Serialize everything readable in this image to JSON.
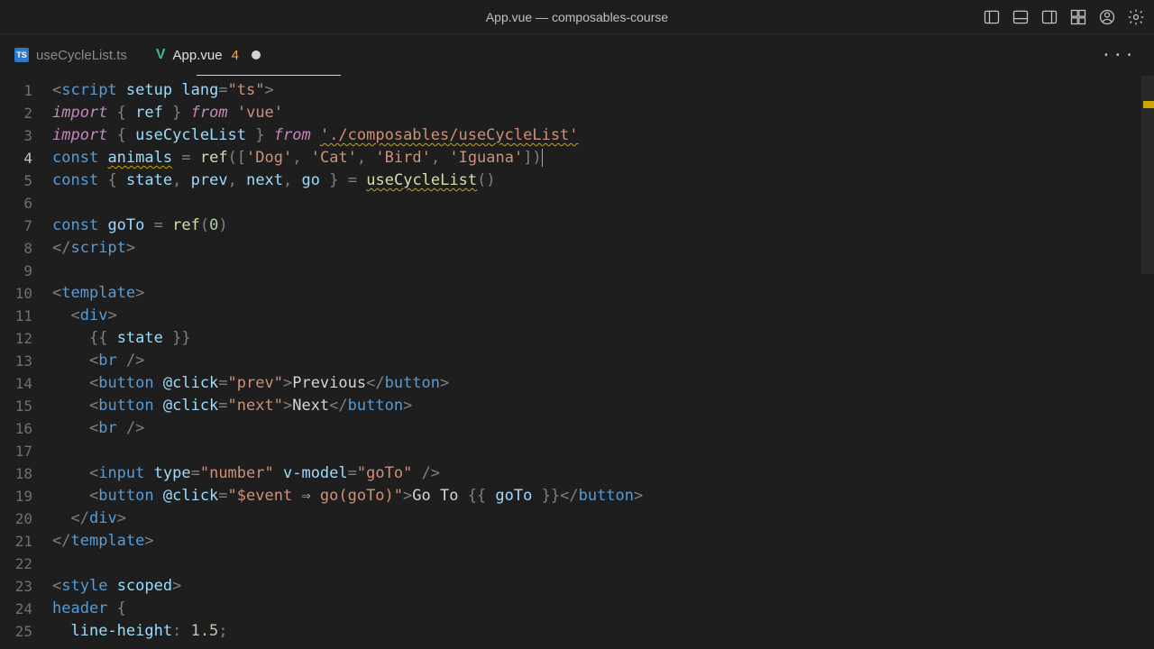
{
  "window": {
    "title": "App.vue — composables-course"
  },
  "tabs": [
    {
      "icon": "ts",
      "label": "useCycleList.ts",
      "active": false
    },
    {
      "icon": "vue",
      "label": "App.vue",
      "badge": "4",
      "dirty": true,
      "active": true
    }
  ],
  "currentLine": 4,
  "lines": [
    {
      "n": 1,
      "t": [
        [
          "pun",
          "<"
        ],
        [
          "tag",
          "script"
        ],
        [
          "txt",
          " "
        ],
        [
          "attr",
          "setup"
        ],
        [
          "txt",
          " "
        ],
        [
          "attr",
          "lang"
        ],
        [
          "pun",
          "="
        ],
        [
          "str",
          "\"ts\""
        ],
        [
          "pun",
          ">"
        ]
      ]
    },
    {
      "n": 2,
      "t": [
        [
          "kw",
          "import"
        ],
        [
          "txt",
          " "
        ],
        [
          "pun",
          "{"
        ],
        [
          "txt",
          " "
        ],
        [
          "var",
          "ref"
        ],
        [
          "txt",
          " "
        ],
        [
          "pun",
          "}"
        ],
        [
          "txt",
          " "
        ],
        [
          "kw",
          "from"
        ],
        [
          "txt",
          " "
        ],
        [
          "str",
          "'vue'"
        ]
      ]
    },
    {
      "n": 3,
      "t": [
        [
          "kw",
          "import"
        ],
        [
          "txt",
          " "
        ],
        [
          "pun",
          "{"
        ],
        [
          "txt",
          " "
        ],
        [
          "var",
          "useCycleList"
        ],
        [
          "txt",
          " "
        ],
        [
          "pun",
          "}"
        ],
        [
          "txt",
          " "
        ],
        [
          "kw",
          "from"
        ],
        [
          "txt",
          " "
        ],
        [
          "str wavy",
          "'./composables/useCycleList'"
        ]
      ]
    },
    {
      "n": 4,
      "t": [
        [
          "kw2",
          "const"
        ],
        [
          "txt",
          " "
        ],
        [
          "var wavy",
          "animals"
        ],
        [
          "txt",
          " "
        ],
        [
          "pun",
          "="
        ],
        [
          "txt",
          " "
        ],
        [
          "fn",
          "ref"
        ],
        [
          "pun",
          "(["
        ],
        [
          "str",
          "'Dog'"
        ],
        [
          "pun",
          ","
        ],
        [
          "txt",
          " "
        ],
        [
          "str",
          "'Cat'"
        ],
        [
          "pun",
          ","
        ],
        [
          "txt",
          " "
        ],
        [
          "str",
          "'Bird'"
        ],
        [
          "pun",
          ","
        ],
        [
          "txt",
          " "
        ],
        [
          "str",
          "'Iguana'"
        ],
        [
          "pun",
          "])"
        ],
        [
          "cursor",
          ""
        ]
      ]
    },
    {
      "n": 5,
      "t": [
        [
          "kw2",
          "const"
        ],
        [
          "txt",
          " "
        ],
        [
          "pun",
          "{"
        ],
        [
          "txt",
          " "
        ],
        [
          "var",
          "state"
        ],
        [
          "pun",
          ","
        ],
        [
          "txt",
          " "
        ],
        [
          "var",
          "prev"
        ],
        [
          "pun",
          ","
        ],
        [
          "txt",
          " "
        ],
        [
          "var",
          "next"
        ],
        [
          "pun",
          ","
        ],
        [
          "txt",
          " "
        ],
        [
          "var",
          "go"
        ],
        [
          "txt",
          " "
        ],
        [
          "pun",
          "}"
        ],
        [
          "txt",
          " "
        ],
        [
          "pun",
          "="
        ],
        [
          "txt",
          " "
        ],
        [
          "fn wavy",
          "useCycleList"
        ],
        [
          "pun",
          "()"
        ]
      ]
    },
    {
      "n": 6,
      "t": []
    },
    {
      "n": 7,
      "t": [
        [
          "kw2",
          "const"
        ],
        [
          "txt",
          " "
        ],
        [
          "var",
          "goTo"
        ],
        [
          "txt",
          " "
        ],
        [
          "pun",
          "="
        ],
        [
          "txt",
          " "
        ],
        [
          "fn",
          "ref"
        ],
        [
          "pun",
          "("
        ],
        [
          "num",
          "0"
        ],
        [
          "pun",
          ")"
        ]
      ]
    },
    {
      "n": 8,
      "t": [
        [
          "pun",
          "</"
        ],
        [
          "tag",
          "script"
        ],
        [
          "pun",
          ">"
        ]
      ]
    },
    {
      "n": 9,
      "t": []
    },
    {
      "n": 10,
      "t": [
        [
          "pun",
          "<"
        ],
        [
          "tag",
          "template"
        ],
        [
          "pun",
          ">"
        ]
      ]
    },
    {
      "n": 11,
      "t": [
        [
          "txt",
          "  "
        ],
        [
          "pun",
          "<"
        ],
        [
          "tag",
          "div"
        ],
        [
          "pun",
          ">"
        ]
      ]
    },
    {
      "n": 12,
      "t": [
        [
          "txt",
          "    "
        ],
        [
          "pun",
          "{{"
        ],
        [
          "txt",
          " "
        ],
        [
          "var",
          "state"
        ],
        [
          "txt",
          " "
        ],
        [
          "pun",
          "}}"
        ]
      ]
    },
    {
      "n": 13,
      "t": [
        [
          "txt",
          "    "
        ],
        [
          "pun",
          "<"
        ],
        [
          "tag",
          "br"
        ],
        [
          "txt",
          " "
        ],
        [
          "pun",
          "/>"
        ]
      ]
    },
    {
      "n": 14,
      "t": [
        [
          "txt",
          "    "
        ],
        [
          "pun",
          "<"
        ],
        [
          "tag",
          "button"
        ],
        [
          "txt",
          " "
        ],
        [
          "attr",
          "@click"
        ],
        [
          "pun",
          "="
        ],
        [
          "str",
          "\"prev\""
        ],
        [
          "pun",
          ">"
        ],
        [
          "txt",
          "Previous"
        ],
        [
          "pun",
          "</"
        ],
        [
          "tag",
          "button"
        ],
        [
          "pun",
          ">"
        ]
      ]
    },
    {
      "n": 15,
      "t": [
        [
          "txt",
          "    "
        ],
        [
          "pun",
          "<"
        ],
        [
          "tag",
          "button"
        ],
        [
          "txt",
          " "
        ],
        [
          "attr",
          "@click"
        ],
        [
          "pun",
          "="
        ],
        [
          "str",
          "\"next\""
        ],
        [
          "pun",
          ">"
        ],
        [
          "txt",
          "Next"
        ],
        [
          "pun",
          "</"
        ],
        [
          "tag",
          "button"
        ],
        [
          "pun",
          ">"
        ]
      ]
    },
    {
      "n": 16,
      "t": [
        [
          "txt",
          "    "
        ],
        [
          "pun",
          "<"
        ],
        [
          "tag",
          "br"
        ],
        [
          "txt",
          " "
        ],
        [
          "pun",
          "/>"
        ]
      ]
    },
    {
      "n": 17,
      "t": []
    },
    {
      "n": 18,
      "t": [
        [
          "txt",
          "    "
        ],
        [
          "pun",
          "<"
        ],
        [
          "tag",
          "input"
        ],
        [
          "txt",
          " "
        ],
        [
          "attr",
          "type"
        ],
        [
          "pun",
          "="
        ],
        [
          "str",
          "\"number\""
        ],
        [
          "txt",
          " "
        ],
        [
          "attr",
          "v-model"
        ],
        [
          "pun",
          "="
        ],
        [
          "str",
          "\"goTo\""
        ],
        [
          "txt",
          " "
        ],
        [
          "pun",
          "/>"
        ]
      ]
    },
    {
      "n": 19,
      "t": [
        [
          "txt",
          "    "
        ],
        [
          "pun",
          "<"
        ],
        [
          "tag",
          "button"
        ],
        [
          "txt",
          " "
        ],
        [
          "attr",
          "@click"
        ],
        [
          "pun",
          "="
        ],
        [
          "str",
          "\"$event ⇒ go(goTo)\""
        ],
        [
          "pun",
          ">"
        ],
        [
          "txt",
          "Go To "
        ],
        [
          "pun",
          "{{"
        ],
        [
          "txt",
          " "
        ],
        [
          "var",
          "goTo"
        ],
        [
          "txt",
          " "
        ],
        [
          "pun",
          "}}"
        ],
        [
          "pun",
          "</"
        ],
        [
          "tag",
          "button"
        ],
        [
          "pun",
          ">"
        ]
      ]
    },
    {
      "n": 20,
      "t": [
        [
          "txt",
          "  "
        ],
        [
          "pun",
          "</"
        ],
        [
          "tag",
          "div"
        ],
        [
          "pun",
          ">"
        ]
      ]
    },
    {
      "n": 21,
      "t": [
        [
          "pun",
          "</"
        ],
        [
          "tag",
          "template"
        ],
        [
          "pun",
          ">"
        ]
      ]
    },
    {
      "n": 22,
      "t": []
    },
    {
      "n": 23,
      "t": [
        [
          "pun",
          "<"
        ],
        [
          "tag",
          "style"
        ],
        [
          "txt",
          " "
        ],
        [
          "attr",
          "scoped"
        ],
        [
          "pun",
          ">"
        ]
      ]
    },
    {
      "n": 24,
      "t": [
        [
          "tag",
          "header"
        ],
        [
          "txt",
          " "
        ],
        [
          "pun",
          "{"
        ]
      ]
    },
    {
      "n": 25,
      "t": [
        [
          "txt",
          "  "
        ],
        [
          "attr",
          "line-height"
        ],
        [
          "pun",
          ":"
        ],
        [
          "txt",
          " "
        ],
        [
          "num",
          "1.5"
        ],
        [
          "pun",
          ";"
        ]
      ]
    }
  ]
}
